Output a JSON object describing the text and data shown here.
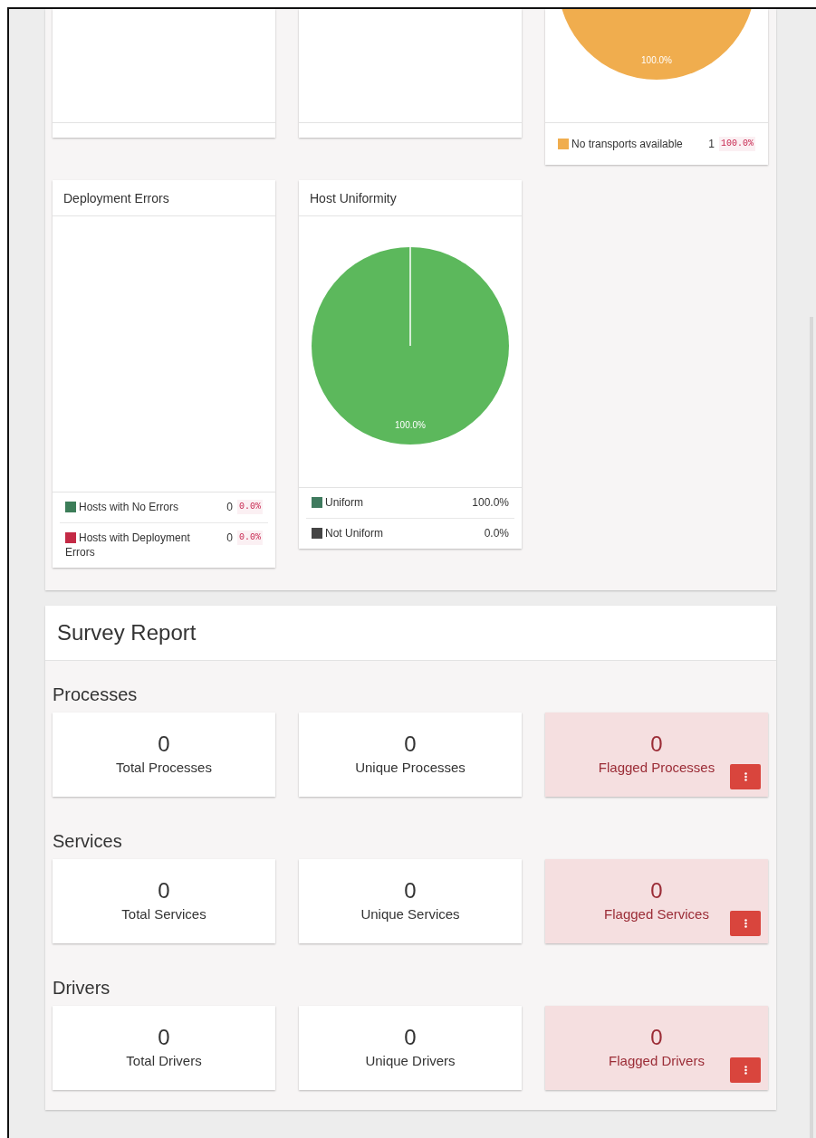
{
  "top_cards": [
    {
      "kind": "blank"
    },
    {
      "kind": "blank"
    },
    {
      "kind": "pie_picture",
      "color": "#f0ad4e",
      "slice_label": "100.0%",
      "legend": [
        {
          "label": "No transports available",
          "count": "1",
          "percent": "100.0%",
          "kind": "code",
          "color": "#f0ad4e"
        }
      ]
    }
  ],
  "chart_cards": [
    {
      "title": "Deployment Errors",
      "kind": "blank",
      "legend": [
        {
          "label": "Hosts with No Errors",
          "count": "0",
          "percent": "0.0%",
          "kind": "code",
          "color": "#3c7d58"
        },
        {
          "label": "Hosts with Deployment Errors",
          "count": "0",
          "percent": "0.0%",
          "kind": "code",
          "color": "#c32a45"
        }
      ]
    },
    {
      "title": "Host Uniformity",
      "kind": "pie_picture",
      "color": "#5cb85c",
      "slice_label": "100.0%",
      "legend": [
        {
          "label": "Uniform",
          "percent": "100.0%",
          "kind": "plain",
          "color": "#3f7a5e"
        },
        {
          "label": "Not Uniform",
          "percent": "0.0%",
          "kind": "plain",
          "color": "#444444"
        }
      ]
    }
  ],
  "survey": {
    "title": "Survey Report",
    "sections": [
      {
        "title": "Processes",
        "stats": [
          {
            "value": "0",
            "label": "Total Processes",
            "flagged": false
          },
          {
            "value": "0",
            "label": "Unique Processes",
            "flagged": false
          },
          {
            "value": "0",
            "label": "Flagged Processes",
            "flagged": true
          }
        ]
      },
      {
        "title": "Services",
        "stats": [
          {
            "value": "0",
            "label": "Total Services",
            "flagged": false
          },
          {
            "value": "0",
            "label": "Unique Services",
            "flagged": false
          },
          {
            "value": "0",
            "label": "Flagged Services",
            "flagged": true
          }
        ]
      },
      {
        "title": "Drivers",
        "stats": [
          {
            "value": "0",
            "label": "Total Drivers",
            "flagged": false
          },
          {
            "value": "0",
            "label": "Unique Drivers",
            "flagged": false
          },
          {
            "value": "0",
            "label": "Flagged Drivers",
            "flagged": true
          }
        ]
      }
    ]
  }
}
